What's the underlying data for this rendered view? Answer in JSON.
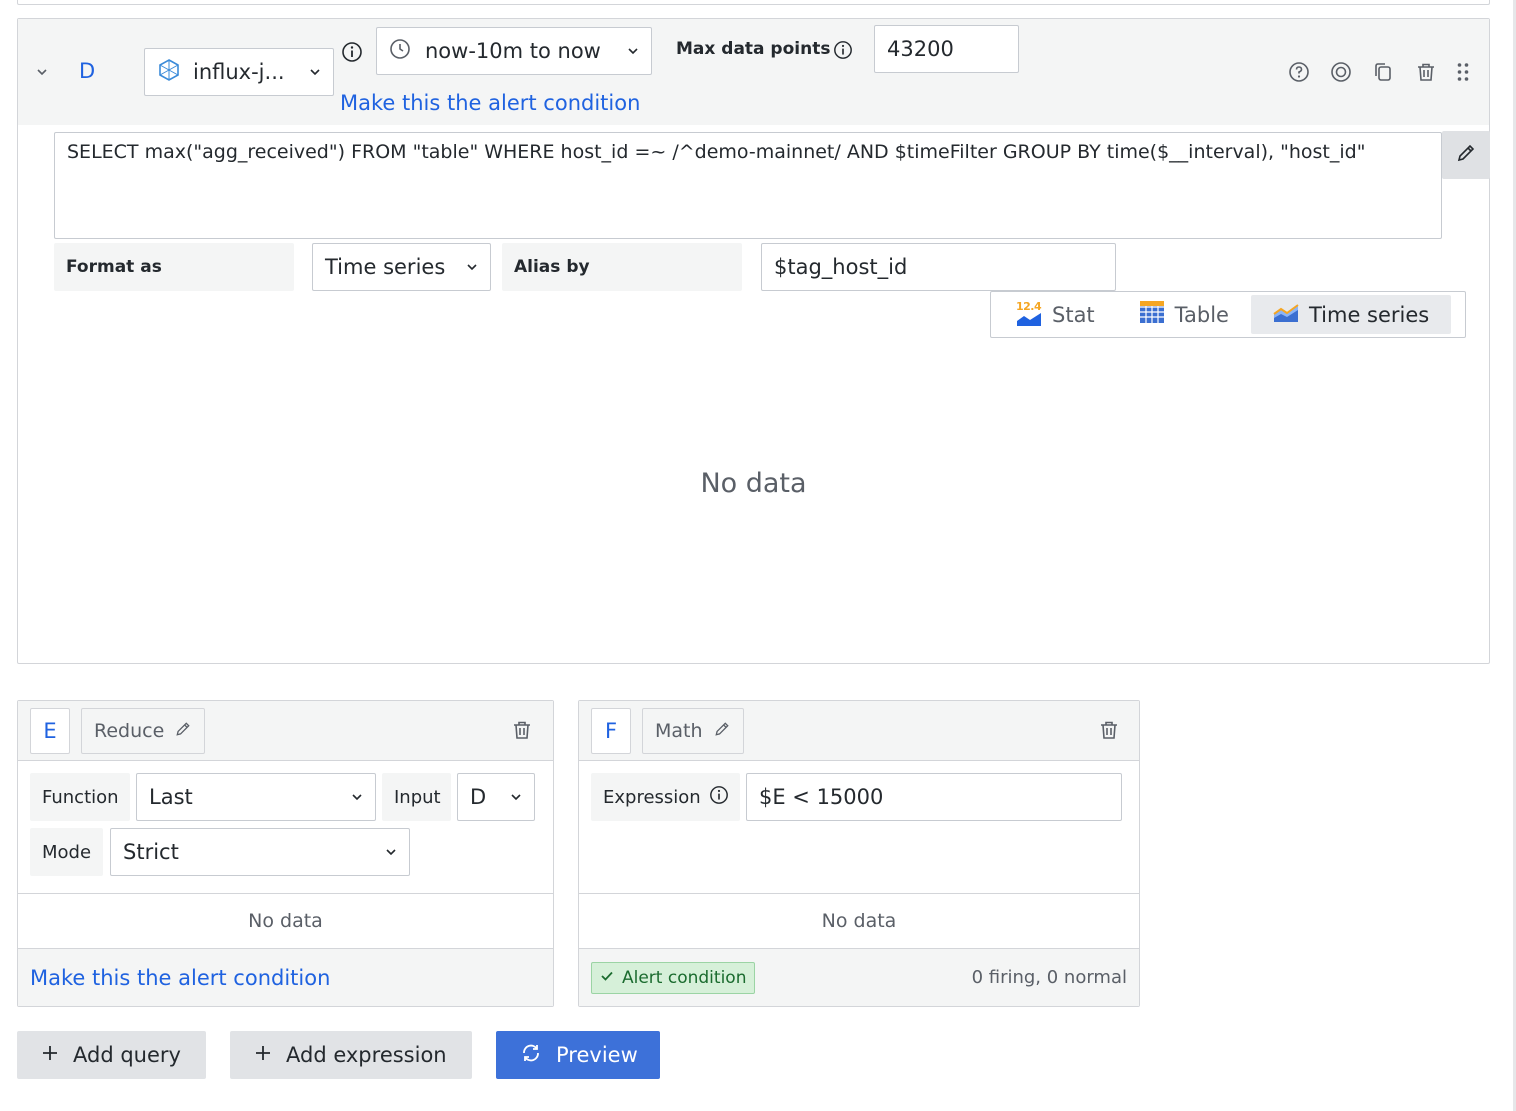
{
  "query_d": {
    "ref": "D",
    "datasource": "influx-j...",
    "time_range": "now-10m to now",
    "max_points_label": "Max data points",
    "max_points_value": "43200",
    "alert_link": "Make this the alert condition",
    "query_text": "SELECT max(\"agg_received\") FROM \"table\" WHERE host_id =~ /^demo-mainnet/ AND $timeFilter GROUP BY time($__interval), \"host_id\"",
    "format_label": "Format as",
    "format_value": "Time series",
    "alias_label": "Alias by",
    "alias_value": "$tag_host_id",
    "viz": {
      "stat_badge": "12.4",
      "stat": "Stat",
      "table": "Table",
      "timeseries": "Time series",
      "active": "timeseries"
    },
    "no_data": "No data"
  },
  "expr_e": {
    "ref": "E",
    "type": "Reduce",
    "function_label": "Function",
    "function_value": "Last",
    "input_label": "Input",
    "input_value": "D",
    "mode_label": "Mode",
    "mode_value": "Strict",
    "no_data": "No data",
    "alert_link": "Make this the alert condition"
  },
  "expr_f": {
    "ref": "F",
    "type": "Math",
    "expression_label": "Expression",
    "expression_value": "$E < 15000",
    "no_data": "No data",
    "alert_badge": "Alert condition",
    "status": "0 firing, 0 normal"
  },
  "actions": {
    "add_query": "Add query",
    "add_expression": "Add expression",
    "preview": "Preview"
  },
  "colors": {
    "link": "#1f62e0",
    "primary": "#3d71d9",
    "alert_bg": "#d6f0d9",
    "alert_text": "#1a7f37"
  }
}
